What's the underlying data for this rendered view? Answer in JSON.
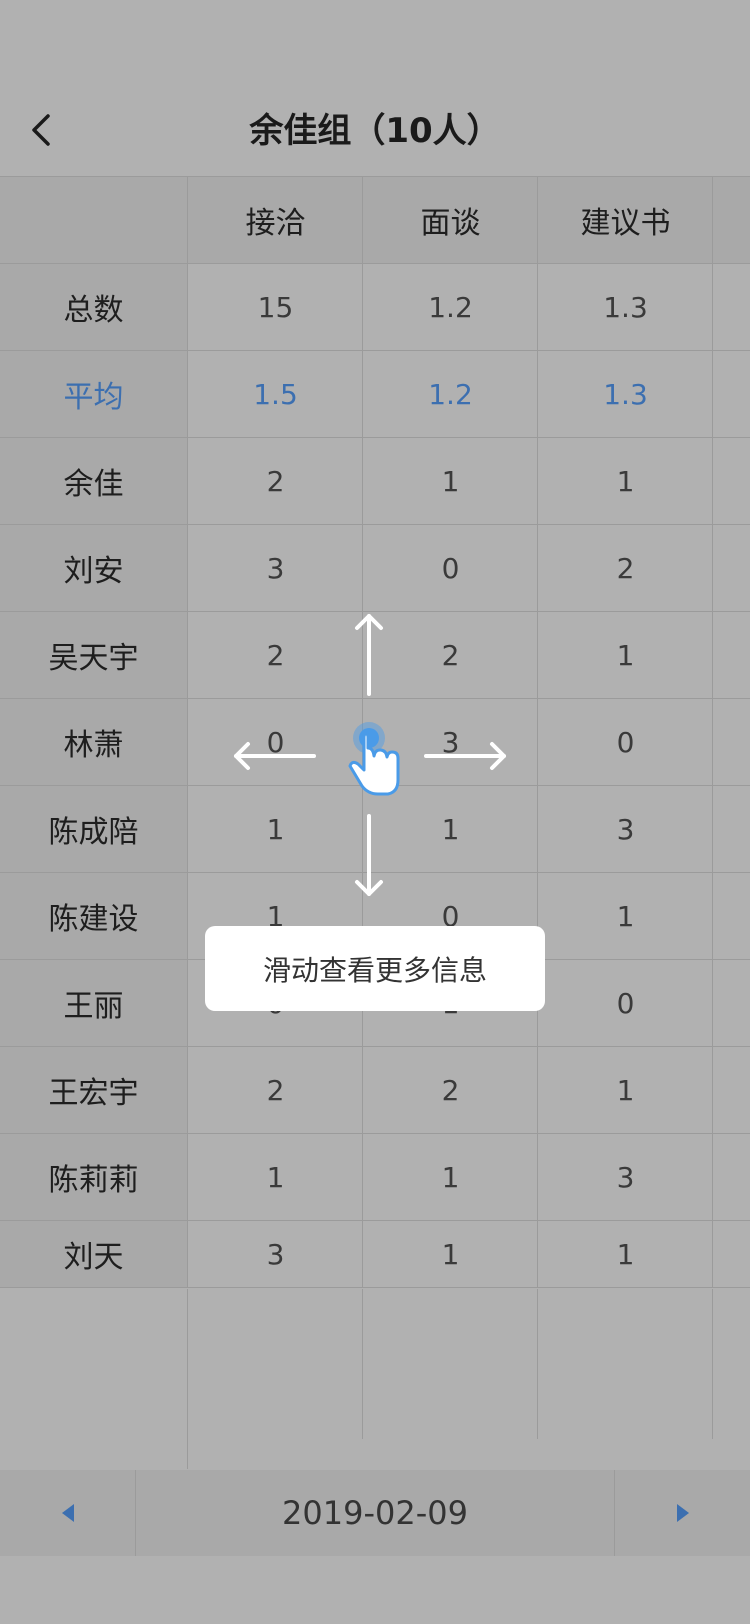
{
  "header": {
    "title": "余佳组（10人）"
  },
  "columns": [
    "接洽",
    "面谈",
    "建议书"
  ],
  "rows": [
    {
      "name": "总数",
      "values": [
        "15",
        "1.2",
        "1.3"
      ]
    },
    {
      "name": "平均",
      "values": [
        "1.5",
        "1.2",
        "1.3"
      ]
    },
    {
      "name": "余佳",
      "values": [
        "2",
        "1",
        "1"
      ]
    },
    {
      "name": "刘安",
      "values": [
        "3",
        "0",
        "2"
      ]
    },
    {
      "name": "吴天宇",
      "values": [
        "2",
        "2",
        "1"
      ]
    },
    {
      "name": "林萧",
      "values": [
        "0",
        "3",
        "0"
      ]
    },
    {
      "name": "陈成陪",
      "values": [
        "1",
        "1",
        "3"
      ]
    },
    {
      "name": "陈建设",
      "values": [
        "1",
        "0",
        "1"
      ]
    },
    {
      "name": "王丽",
      "values": [
        "0",
        "1",
        "0"
      ]
    },
    {
      "name": "王宏宇",
      "values": [
        "2",
        "2",
        "1"
      ]
    },
    {
      "name": "陈莉莉",
      "values": [
        "1",
        "1",
        "3"
      ]
    },
    {
      "name": "刘天",
      "values": [
        "3",
        "1",
        "1"
      ]
    }
  ],
  "date_bar": {
    "date": "2019-02-09"
  },
  "toast": {
    "text": "滑动查看更多信息"
  },
  "colors": {
    "accent": "#3c6fb0",
    "overlay": "#b1b1b1",
    "hand": "#4a9be8"
  },
  "icons": {
    "back": "chevron-left-icon",
    "prev": "triangle-left-icon",
    "next": "triangle-right-icon",
    "gesture": "swipe-hand-icon"
  }
}
